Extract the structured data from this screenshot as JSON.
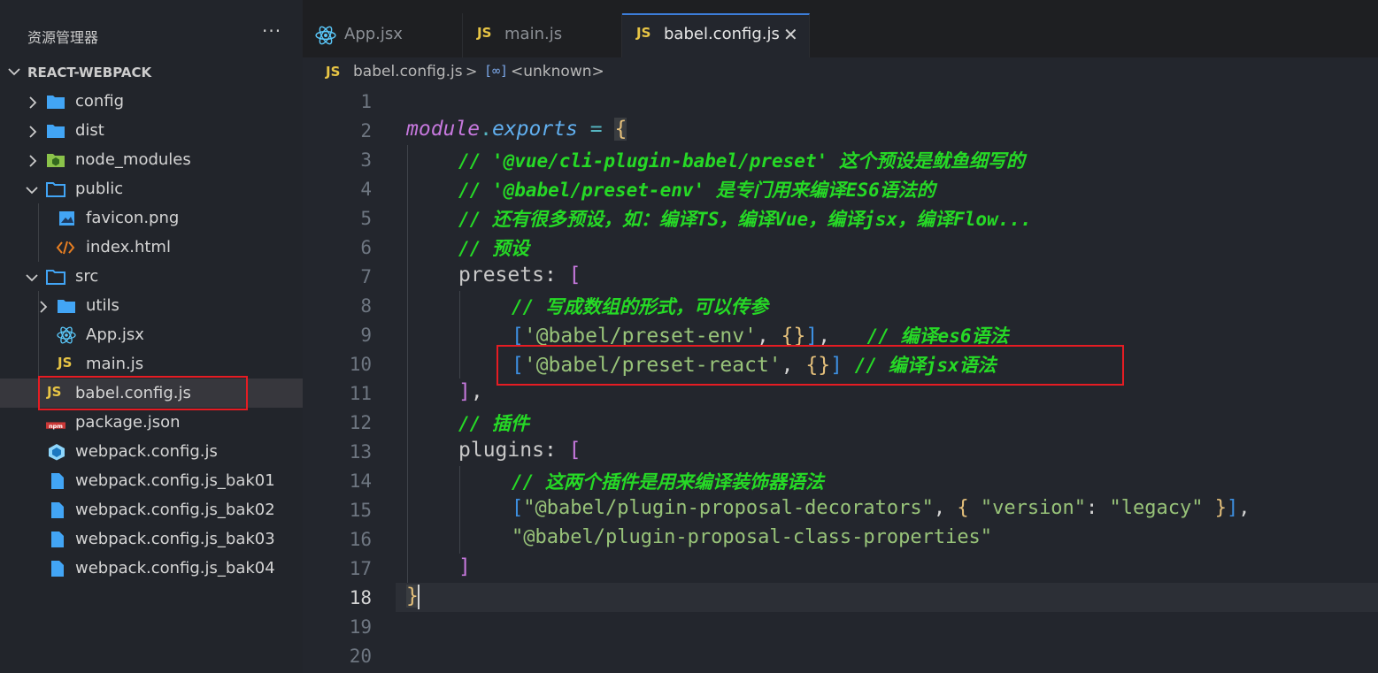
{
  "sidebar": {
    "title": "资源管理器",
    "more": "···",
    "project": "REACT-WEBPACK",
    "items": [
      {
        "label": "config",
        "icon": "folder-icon"
      },
      {
        "label": "dist",
        "icon": "folder-icon"
      },
      {
        "label": "node_modules",
        "icon": "node-folder-icon"
      },
      {
        "label": "public",
        "icon": "folder-open-icon"
      },
      {
        "label": "favicon.png",
        "icon": "image-icon"
      },
      {
        "label": "index.html",
        "icon": "html-icon"
      },
      {
        "label": "src",
        "icon": "folder-open-icon"
      },
      {
        "label": "utils",
        "icon": "folder-icon"
      },
      {
        "label": "App.jsx",
        "icon": "react-icon"
      },
      {
        "label": "main.js",
        "icon": "js-icon"
      },
      {
        "label": "babel.config.js",
        "icon": "js-icon"
      },
      {
        "label": "package.json",
        "icon": "npm-icon"
      },
      {
        "label": "webpack.config.js",
        "icon": "webpack-icon"
      },
      {
        "label": "webpack.config.js_bak01",
        "icon": "file-icon"
      },
      {
        "label": "webpack.config.js_bak02",
        "icon": "file-icon"
      },
      {
        "label": "webpack.config.js_bak03",
        "icon": "file-icon"
      },
      {
        "label": "webpack.config.js_bak04",
        "icon": "file-icon"
      }
    ]
  },
  "tabs": [
    {
      "label": "App.jsx",
      "icon": "react-icon"
    },
    {
      "label": "main.js",
      "icon": "js-icon",
      "badge": "JS"
    },
    {
      "label": "babel.config.js",
      "icon": "js-icon",
      "badge": "JS",
      "close": "✕"
    }
  ],
  "breadcrumb": {
    "badge": "JS",
    "file": "babel.config.js",
    "separator": ">",
    "symbol_icon": "[∞]",
    "symbol": "<unknown>"
  },
  "editor": {
    "line_numbers": [
      "1",
      "2",
      "3",
      "4",
      "5",
      "6",
      "7",
      "8",
      "9",
      "10",
      "11",
      "12",
      "13",
      "14",
      "15",
      "16",
      "17",
      "18",
      "19",
      "20"
    ],
    "current_line": "18",
    "lines": {
      "l2": {
        "a": "module",
        "b": ".",
        "c": "exports",
        "d": " = ",
        "e": "{"
      },
      "l3": {
        "c": "// '@vue/cli-plugin-babel/preset' 这个预设是鱿鱼细写的"
      },
      "l4": {
        "c": "// '@babel/preset-env' 是专门用来编译ES6语法的"
      },
      "l5": {
        "c": "// 还有很多预设，如：编译TS，编译Vue，编译jsx，编译Flow..."
      },
      "l6": {
        "c": "// 预设"
      },
      "l7": {
        "k": "presets",
        "p": ": ",
        "b": "["
      },
      "l8": {
        "c": "// 写成数组的形式，可以传参"
      },
      "l9": {
        "o": "[",
        "s": "'@babel/preset-env'",
        "p": ", ",
        "br": "{}",
        "cl": "]",
        "p2": ",   ",
        "c": "// 编译es6语法"
      },
      "l10": {
        "o": "[",
        "s": "'@babel/preset-react'",
        "p": ", ",
        "br": "{}",
        "cl": "]",
        "p2": " ",
        "c": "// 编译jsx语法"
      },
      "l11": {
        "b": "]",
        "p": ","
      },
      "l12": {
        "c": "// 插件"
      },
      "l13": {
        "k": "plugins",
        "p": ": ",
        "b": "["
      },
      "l14": {
        "c": "// 这两个插件是用来编译装饰器语法"
      },
      "l15": {
        "o": "[",
        "s1": "\"@babel/plugin-proposal-decorators\"",
        "p1": ", ",
        "ob": "{",
        "s2": " \"version\"",
        "p2": ": ",
        "s3": "\"legacy\"",
        "cb": " }",
        "cl": "]",
        "p3": ","
      },
      "l16": {
        "s": "\"@babel/plugin-proposal-class-properties\""
      },
      "l17": {
        "b": "]"
      },
      "l18": {
        "b": "}"
      }
    }
  },
  "colors": {
    "selection_box": "#e51c23",
    "comment": "#26d926",
    "string": "#98c379",
    "keyword": "#c678dd",
    "accent": "#3c7dd9"
  }
}
